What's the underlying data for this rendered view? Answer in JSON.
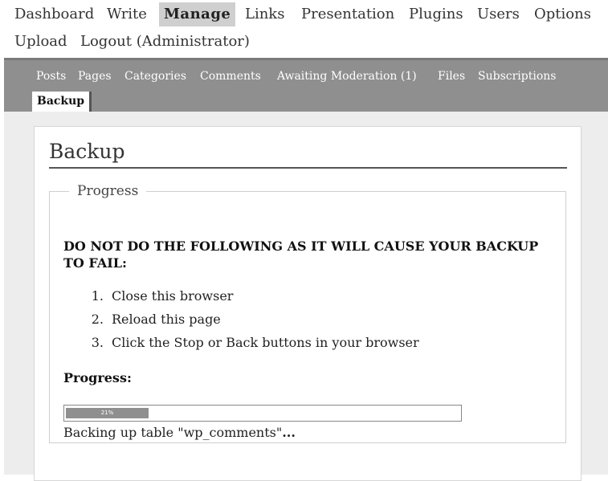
{
  "top_menu": {
    "items": [
      {
        "label": "Dashboard",
        "current": false
      },
      {
        "label": "Write",
        "current": false
      },
      {
        "label": "Manage",
        "current": true
      },
      {
        "label": "Links",
        "current": false
      },
      {
        "label": "Presentation",
        "current": false
      },
      {
        "label": "Plugins",
        "current": false
      },
      {
        "label": "Users",
        "current": false
      },
      {
        "label": "Options",
        "current": false
      },
      {
        "label": "Upload",
        "current": false
      },
      {
        "label": "Logout (Administrator)",
        "current": false
      }
    ]
  },
  "sub_menu": {
    "items": [
      {
        "label": "Posts"
      },
      {
        "label": "Pages"
      },
      {
        "label": "Categories"
      },
      {
        "label": "Comments"
      },
      {
        "label": "Awaiting Moderation (1)"
      },
      {
        "label": "Files"
      },
      {
        "label": "Subscriptions"
      }
    ],
    "current_tab": "Backup"
  },
  "page": {
    "title": "Backup",
    "fieldset_legend": "Progress",
    "warning": "DO NOT DO THE FOLLOWING AS IT WILL CAUSE YOUR BACKUP TO FAIL:",
    "steps": [
      {
        "num": "1.",
        "text": "Close this browser"
      },
      {
        "num": "2.",
        "text": "Reload this page"
      },
      {
        "num": "3.",
        "text": "Click the Stop or Back buttons in your browser"
      }
    ],
    "progress_heading": "Progress:",
    "progress_percent_label": "21%",
    "progress_fraction": 0.21,
    "status_text": "Backing up table \"wp_comments\"",
    "status_ellipsis": "..."
  },
  "colors": {
    "submenu_bg": "#8f8f8f",
    "current_top_bg": "#cfcfcf",
    "progress_fill": "#8f8f8f"
  }
}
